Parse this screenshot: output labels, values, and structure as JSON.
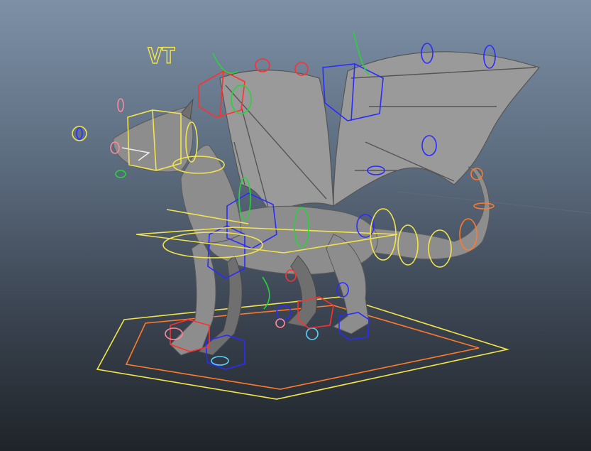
{
  "viewport": {
    "marker_text": "VT"
  },
  "colors": {
    "background_top": "#7d90a6",
    "background_bottom": "#1f2429",
    "mesh": "#8d8d8d",
    "control_yellow": "#f2e44a",
    "control_red": "#ff3030",
    "control_blue": "#2b2bff",
    "control_green": "#27d43a",
    "control_orange": "#ff7a2a",
    "control_cyan": "#5ad2ff"
  },
  "icons": [
    "dragon-rig-model",
    "ground-control-shape",
    "ik-control-box",
    "fk-control-ring"
  ]
}
